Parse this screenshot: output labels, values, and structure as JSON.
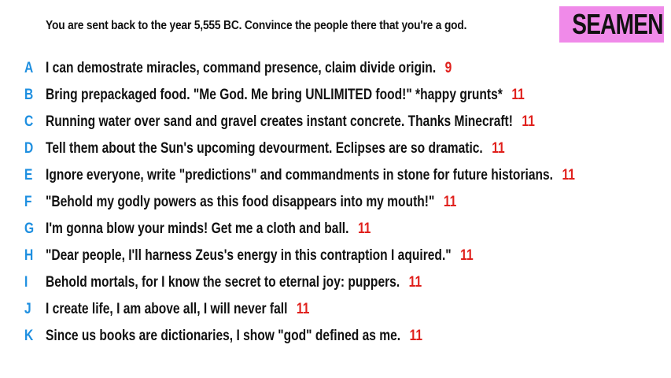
{
  "prompt": "You are sent back to the year 5,555 BC. Convince the people there that you're a god.",
  "logo": "SEAMEN",
  "colors": {
    "letter": "#1e8fe0",
    "score": "#e0201c",
    "logo_bg": "#f08ae9",
    "text": "#111111"
  },
  "answers": [
    {
      "letter": "A",
      "text": "I can demostrate miracles, command presence, claim divide origin.",
      "score": "9"
    },
    {
      "letter": "B",
      "text": "Bring prepackaged food. \"Me God. Me bring UNLIMITED food!\" *happy grunts*",
      "score": "11"
    },
    {
      "letter": "C",
      "text": "Running water over sand and gravel creates instant concrete. Thanks Minecraft!",
      "score": "11"
    },
    {
      "letter": "D",
      "text": "Tell them about the Sun's upcoming devourment. Eclipses are so dramatic.",
      "score": "11"
    },
    {
      "letter": "E",
      "text": "Ignore everyone, write \"predictions\" and commandments in stone for future historians.",
      "score": "11"
    },
    {
      "letter": "F",
      "text": "\"Behold my godly powers as this food disappears into my mouth!\"",
      "score": "11"
    },
    {
      "letter": "G",
      "text": "I'm gonna blow your minds! Get me a cloth and ball.",
      "score": "11"
    },
    {
      "letter": "H",
      "text": "\"Dear people, I'll harness Zeus's energy in this contraption I aquired.\"",
      "score": "11"
    },
    {
      "letter": "I",
      "text": "Behold mortals, for I know the secret to eternal joy: puppers.",
      "score": "11"
    },
    {
      "letter": "J",
      "text": "I create life, I am above all, I will never fall",
      "score": "11"
    },
    {
      "letter": "K",
      "text": "Since us books are dictionaries, I show \"god\" defined as me.",
      "score": "11"
    }
  ]
}
